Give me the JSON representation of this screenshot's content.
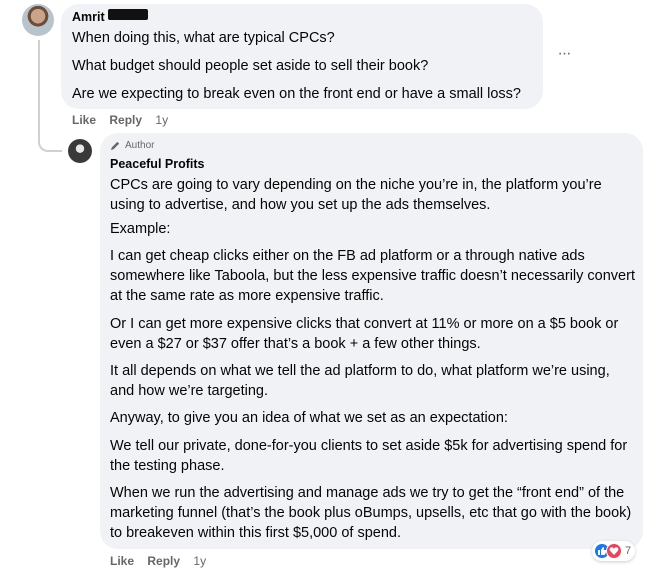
{
  "main_comment": {
    "author": "Amrit",
    "lines": [
      "When doing this, what are typical CPCs?",
      "What budget should people set aside to sell their book?",
      "Are we expecting to break even on the front end or have a small loss?"
    ],
    "actions": {
      "like": "Like",
      "reply": "Reply",
      "time": "1y"
    }
  },
  "reply_comment": {
    "badge": "Author",
    "author": "Peaceful Profits",
    "paragraphs": [
      "CPCs are going to vary depending on the niche you’re in, the platform you’re using to advertise, and how you set up the ads themselves.",
      "Example:",
      "I can get cheap clicks either on the FB ad platform or a through native ads somewhere like Taboola, but the less expensive traffic doesn’t necessarily convert at the same rate as more expensive traffic.",
      "Or I can get more expensive clicks that convert at 11% or more on a $5 book or even a $27 or $37 offer that’s a book + a few other things.",
      "It all depends on what we tell the ad platform to do, what platform we’re using, and how we’re targeting.",
      "Anyway, to give you an idea of what we set as an expectation:",
      "We tell our private, done-for-you clients to set aside $5k for advertising spend for the testing phase.",
      "When we run the advertising and manage ads we try to get the “front end” of the marketing funnel (that’s the book plus oBumps, upsells, etc that go with the book) to breakeven within this first $5,000 of spend."
    ],
    "actions": {
      "like": "Like",
      "reply": "Reply",
      "time": "1y"
    },
    "reactions": {
      "count": "7",
      "icons": [
        "like-icon",
        "love-icon"
      ]
    }
  },
  "more_options": "···",
  "colors": {
    "bubble": "#f0f2f5",
    "meta": "#65676b",
    "like": "#1877f2",
    "love": "#f33e58"
  }
}
